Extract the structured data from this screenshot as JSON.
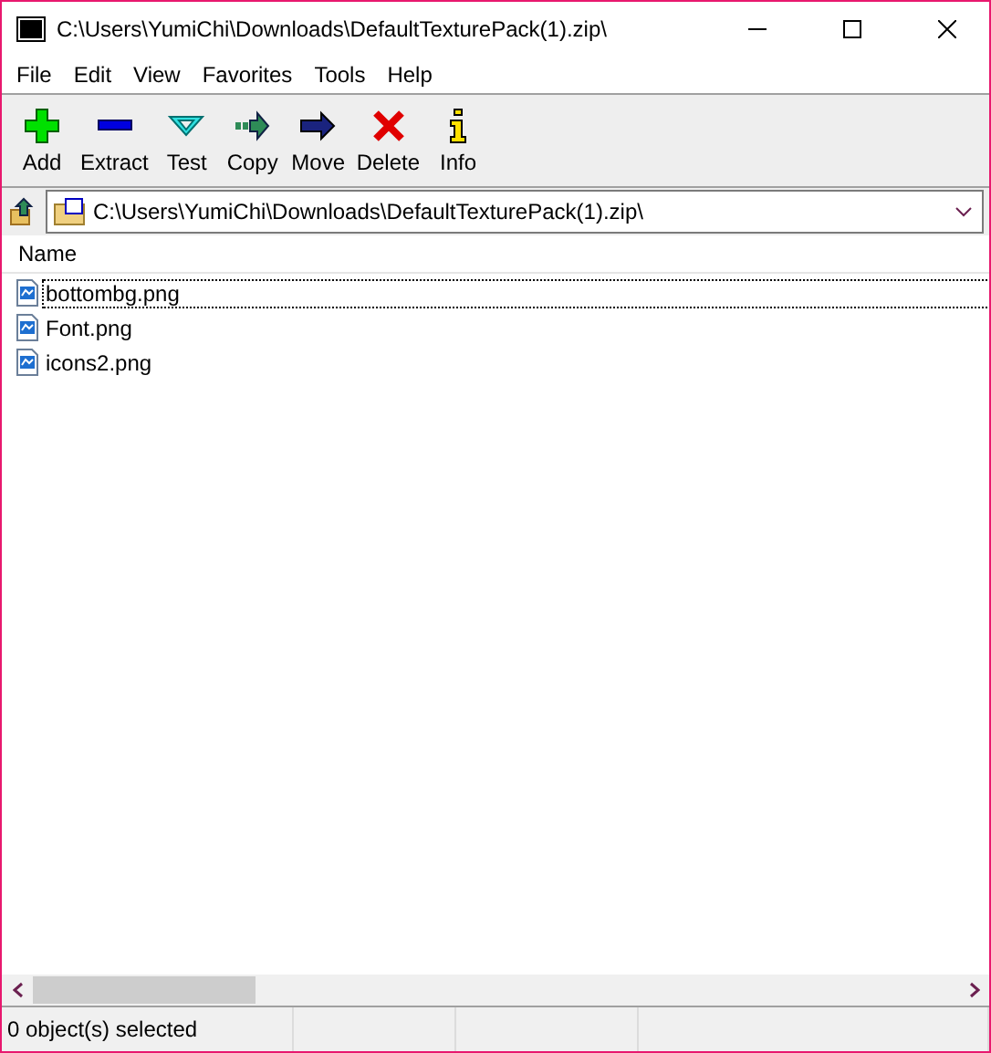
{
  "window": {
    "title": "C:\\Users\\YumiChi\\Downloads\\DefaultTexturePack(1).zip\\"
  },
  "menu": [
    "File",
    "Edit",
    "View",
    "Favorites",
    "Tools",
    "Help"
  ],
  "toolbar": [
    {
      "label": "Add",
      "kind": "add"
    },
    {
      "label": "Extract",
      "kind": "extract"
    },
    {
      "label": "Test",
      "kind": "test"
    },
    {
      "label": "Copy",
      "kind": "copy"
    },
    {
      "label": "Move",
      "kind": "move"
    },
    {
      "label": "Delete",
      "kind": "delete"
    },
    {
      "label": "Info",
      "kind": "info"
    }
  ],
  "address": {
    "value": "C:\\Users\\YumiChi\\Downloads\\DefaultTexturePack(1).zip\\"
  },
  "table": {
    "columns": [
      "Name"
    ],
    "rows": [
      {
        "name": "bottombg.png",
        "focused": true
      },
      {
        "name": "Font.png",
        "focused": false
      },
      {
        "name": "icons2.png",
        "focused": false
      }
    ]
  },
  "status_bar": [
    "0 object(s) selected"
  ]
}
